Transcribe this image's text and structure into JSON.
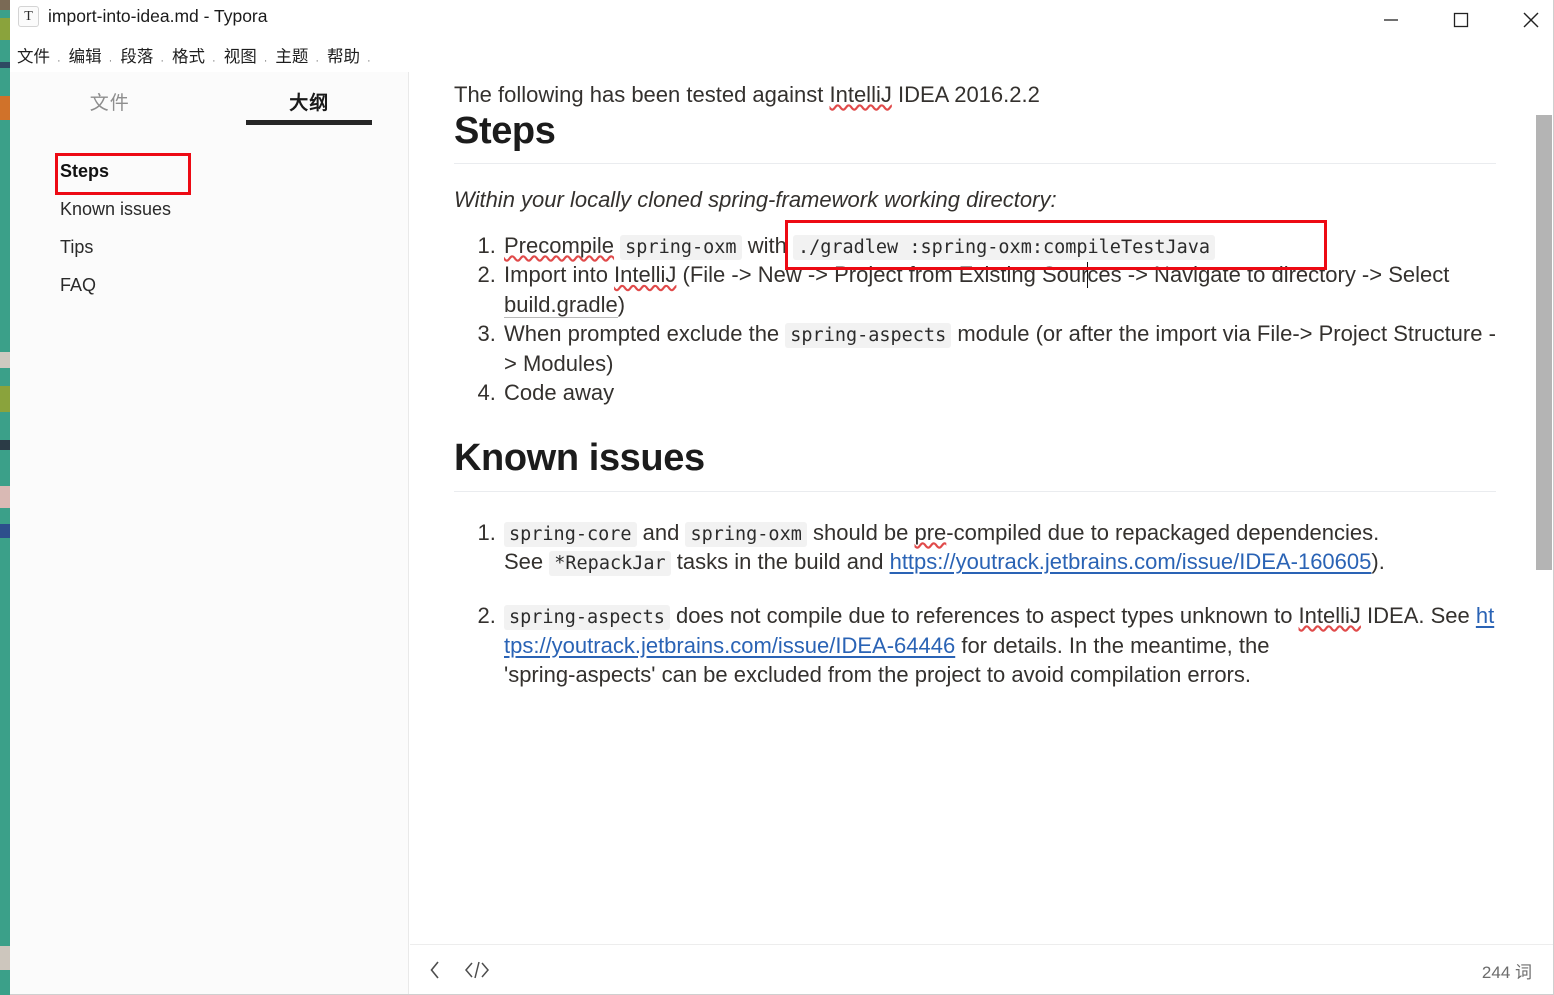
{
  "window": {
    "app_icon_glyph": "T",
    "title": "import-into-idea.md - Typora",
    "controls": {
      "minimize": "minimize-button",
      "maximize": "maximize-button",
      "close": "close-button"
    }
  },
  "menubar": {
    "items": [
      "文件",
      "编辑",
      "段落",
      "格式",
      "视图",
      "主题",
      "帮助"
    ],
    "separator": "·"
  },
  "sidebar": {
    "tabs": [
      {
        "label": "文件",
        "active": false
      },
      {
        "label": "大纲",
        "active": true
      }
    ],
    "outline": [
      {
        "label": "Steps",
        "level": 2,
        "highlighted": true
      },
      {
        "label": "Known issues",
        "level": 3,
        "highlighted": false
      },
      {
        "label": "Tips",
        "level": 3,
        "highlighted": false
      },
      {
        "label": "FAQ",
        "level": 3,
        "highlighted": false
      }
    ]
  },
  "document": {
    "intro": {
      "before": "The following has been tested against ",
      "misspelled": "IntelliJ",
      "after": " IDEA 2016.2.2"
    },
    "h1_steps": "Steps",
    "steps_lead": "Within your locally cloned spring-framework working directory:",
    "steps": {
      "item1": {
        "word_precompile": "Precompile",
        "code_oxm": "spring-oxm",
        "word_with": "with",
        "code_gradlew": "./gradlew :spring-oxm:compileTestJava"
      },
      "item2": {
        "t1": "Import into ",
        "misspelled": "IntelliJ",
        "t2": " (File -> New -> Project from Existing Sour",
        "t3": "ces -> Navigate to directory -> Select ",
        "link_like": "build.gradle",
        "t4": ")"
      },
      "item3": {
        "t1": "When prompted exclude the ",
        "code": "spring-aspects",
        "t2": " module (or after the import via File-> Project Structure -> Modules)"
      },
      "item4": {
        "t1": "Code away"
      }
    },
    "h1_known_issues": "Known issues",
    "known_issues": {
      "item1": {
        "code_core": "spring-core",
        "t1": " and ",
        "code_oxm": "spring-oxm",
        "t2": " should be ",
        "misspelled": "pre",
        "t3": "-compiled due to repackaged dependencies.",
        "t4": "See ",
        "code_repackjar": "*RepackJar",
        "t5": " tasks in the build and ",
        "link": "https://youtrack.jetbrains.com/issue/IDEA-160605",
        "t6": ")."
      },
      "item2": {
        "code_aspects": "spring-aspects",
        "t1": " does not compile due to references to aspect types unknown to ",
        "misspelled": "IntelliJ",
        "t2": " IDEA. See ",
        "link": "https://youtrack.jetbrains.com/issue/IDEA-64446",
        "t3": " for details. In the meantime, the",
        "t4": "'spring-aspects' can be excluded from the project to avoid compilation errors."
      }
    }
  },
  "statusbar": {
    "back_icon": "chevron-left-icon",
    "source_icon": "</>",
    "word_count": "244 词"
  },
  "colors": {
    "annotation_red": "#ed0a14",
    "link_blue": "#2a63b5",
    "desktop_teal": "#3ba089",
    "code_bg": "#f2f2f2",
    "scrollbar": "#b4b4b4"
  }
}
